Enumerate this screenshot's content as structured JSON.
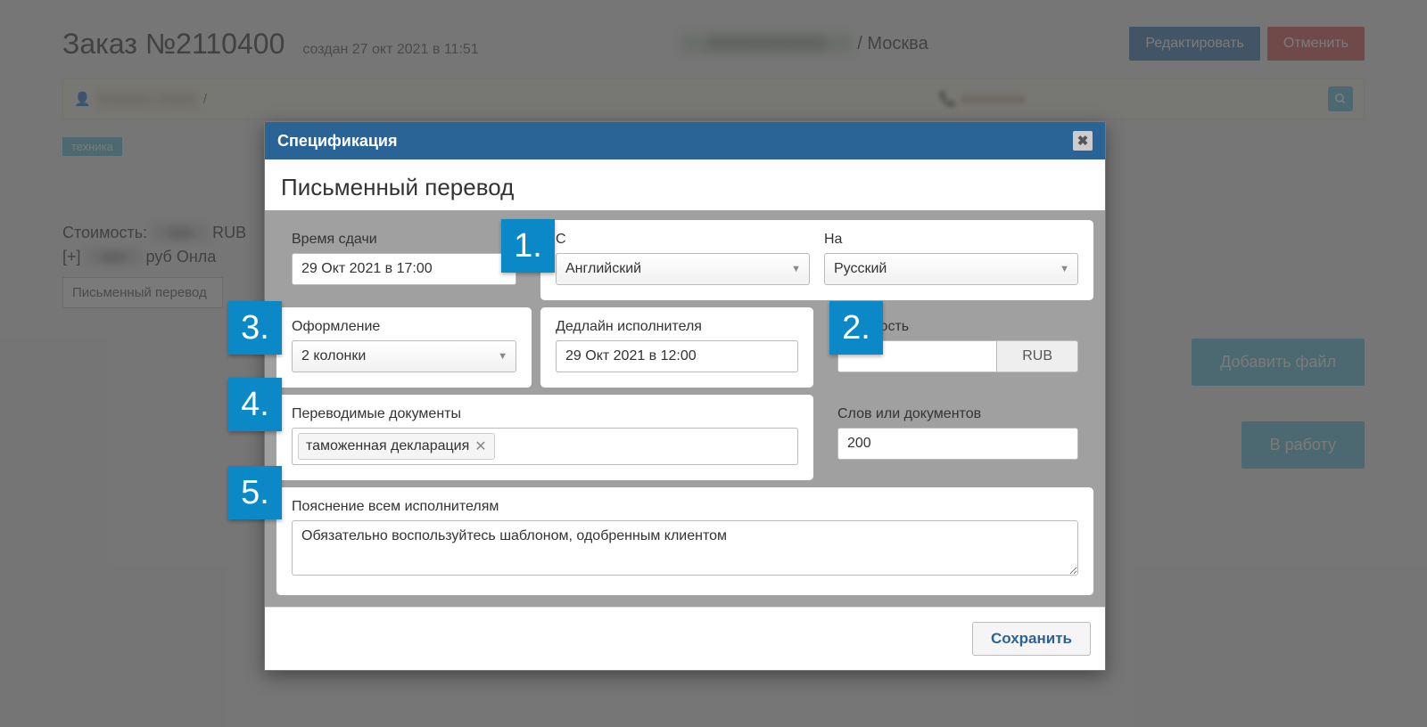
{
  "header": {
    "title": "Заказ №2110400",
    "subtitle": "создан 27 окт 2021 в 11:51",
    "customer_city": " / Москва",
    "edit_label": "Редактировать",
    "cancel_label": "Отменить"
  },
  "bar": {
    "slash": " /"
  },
  "tag_label": "техника",
  "cost": {
    "label": "Стоимость:   ",
    "currency_suffix": " RUB",
    "sub_prefix": "[+] ",
    "sub_suffix": " руб Онла"
  },
  "translation_field": "Письменный перевод",
  "actions": {
    "add_file": "Добавить файл",
    "to_work": "В работу"
  },
  "dialog": {
    "title": "Спецификация",
    "section": "Письменный перевод",
    "delivery_time": {
      "label": "Время сдачи",
      "value": "29 Окт 2021 в 17:00"
    },
    "lang_from": {
      "label": "С",
      "value": "Английский"
    },
    "lang_to": {
      "label": "На",
      "value": "Русский"
    },
    "layout": {
      "label": "Оформление",
      "value": "2 колонки"
    },
    "deadline": {
      "label": "Дедлайн исполнителя",
      "value": "29 Окт 2021 в 12:00"
    },
    "price": {
      "label": "Стоимость",
      "currency": "RUB"
    },
    "documents": {
      "label": "Переводимые документы",
      "tag": "таможенная декларация"
    },
    "words": {
      "label": "Слов или документов",
      "value": "200"
    },
    "note": {
      "label": "Пояснение всем исполнителям",
      "value": "Обязательно воспользуйтесь шаблоном, одобренным клиентом"
    },
    "save_label": "Сохранить"
  },
  "callouts": [
    "1.",
    "2.",
    "3.",
    "4.",
    "5."
  ]
}
